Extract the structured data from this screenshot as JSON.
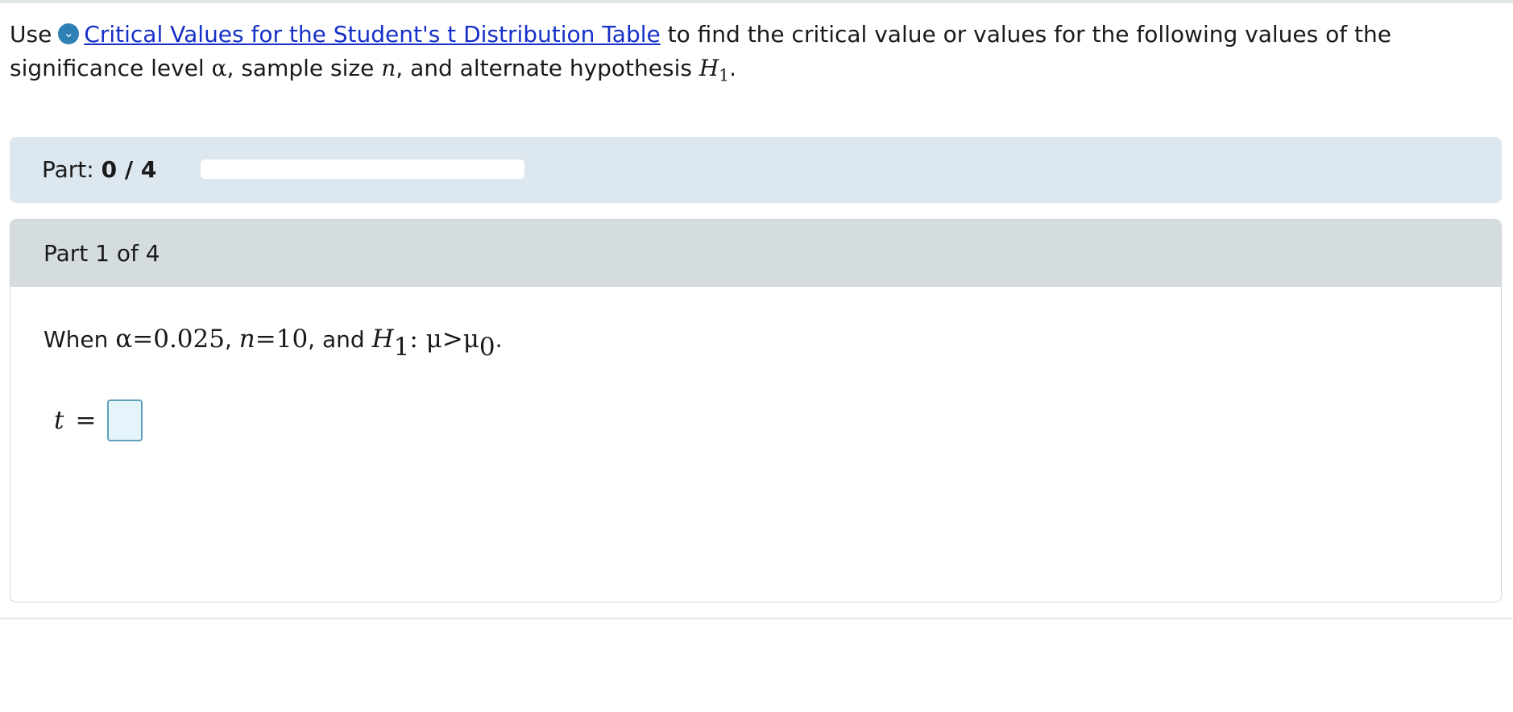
{
  "intro": {
    "prefix": "Use",
    "icon": "download-chevron-icon",
    "icon_glyph": "⌄",
    "link_text": "Critical Values for the Student's t Distribution Table",
    "text_after_link": " to find the critical value or values for the following values of the significance level ",
    "alpha": "α",
    "sep1": ", sample size ",
    "n": "n",
    "sep2": ", and alternate hypothesis ",
    "H": "H",
    "H_sub": "1",
    "end": "."
  },
  "progress": {
    "label": "Part: ",
    "value_text": "0 / 4",
    "fraction": 0,
    "track_color": "#ffffff",
    "band_color": "#dde7f0"
  },
  "part": {
    "title": "Part 1 of 4",
    "question": {
      "prefix": "When ",
      "alpha_expr": "α=0.025",
      "comma1": ", ",
      "n_var": "n",
      "n_rest": "=10",
      "and_text": ", and ",
      "H": "H",
      "H_sub": "1",
      "colon_mu": ": μ>μ",
      "mu_sub": "0",
      "end": "."
    },
    "answer": {
      "variable": "t",
      "equals": "=",
      "value": ""
    }
  },
  "colors": {
    "link": "#1530c8",
    "icon_bg": "#2f80b5",
    "card_header": "#d5dce0",
    "answer_border": "#5f9fb9",
    "answer_bg": "#e5f3fb"
  }
}
